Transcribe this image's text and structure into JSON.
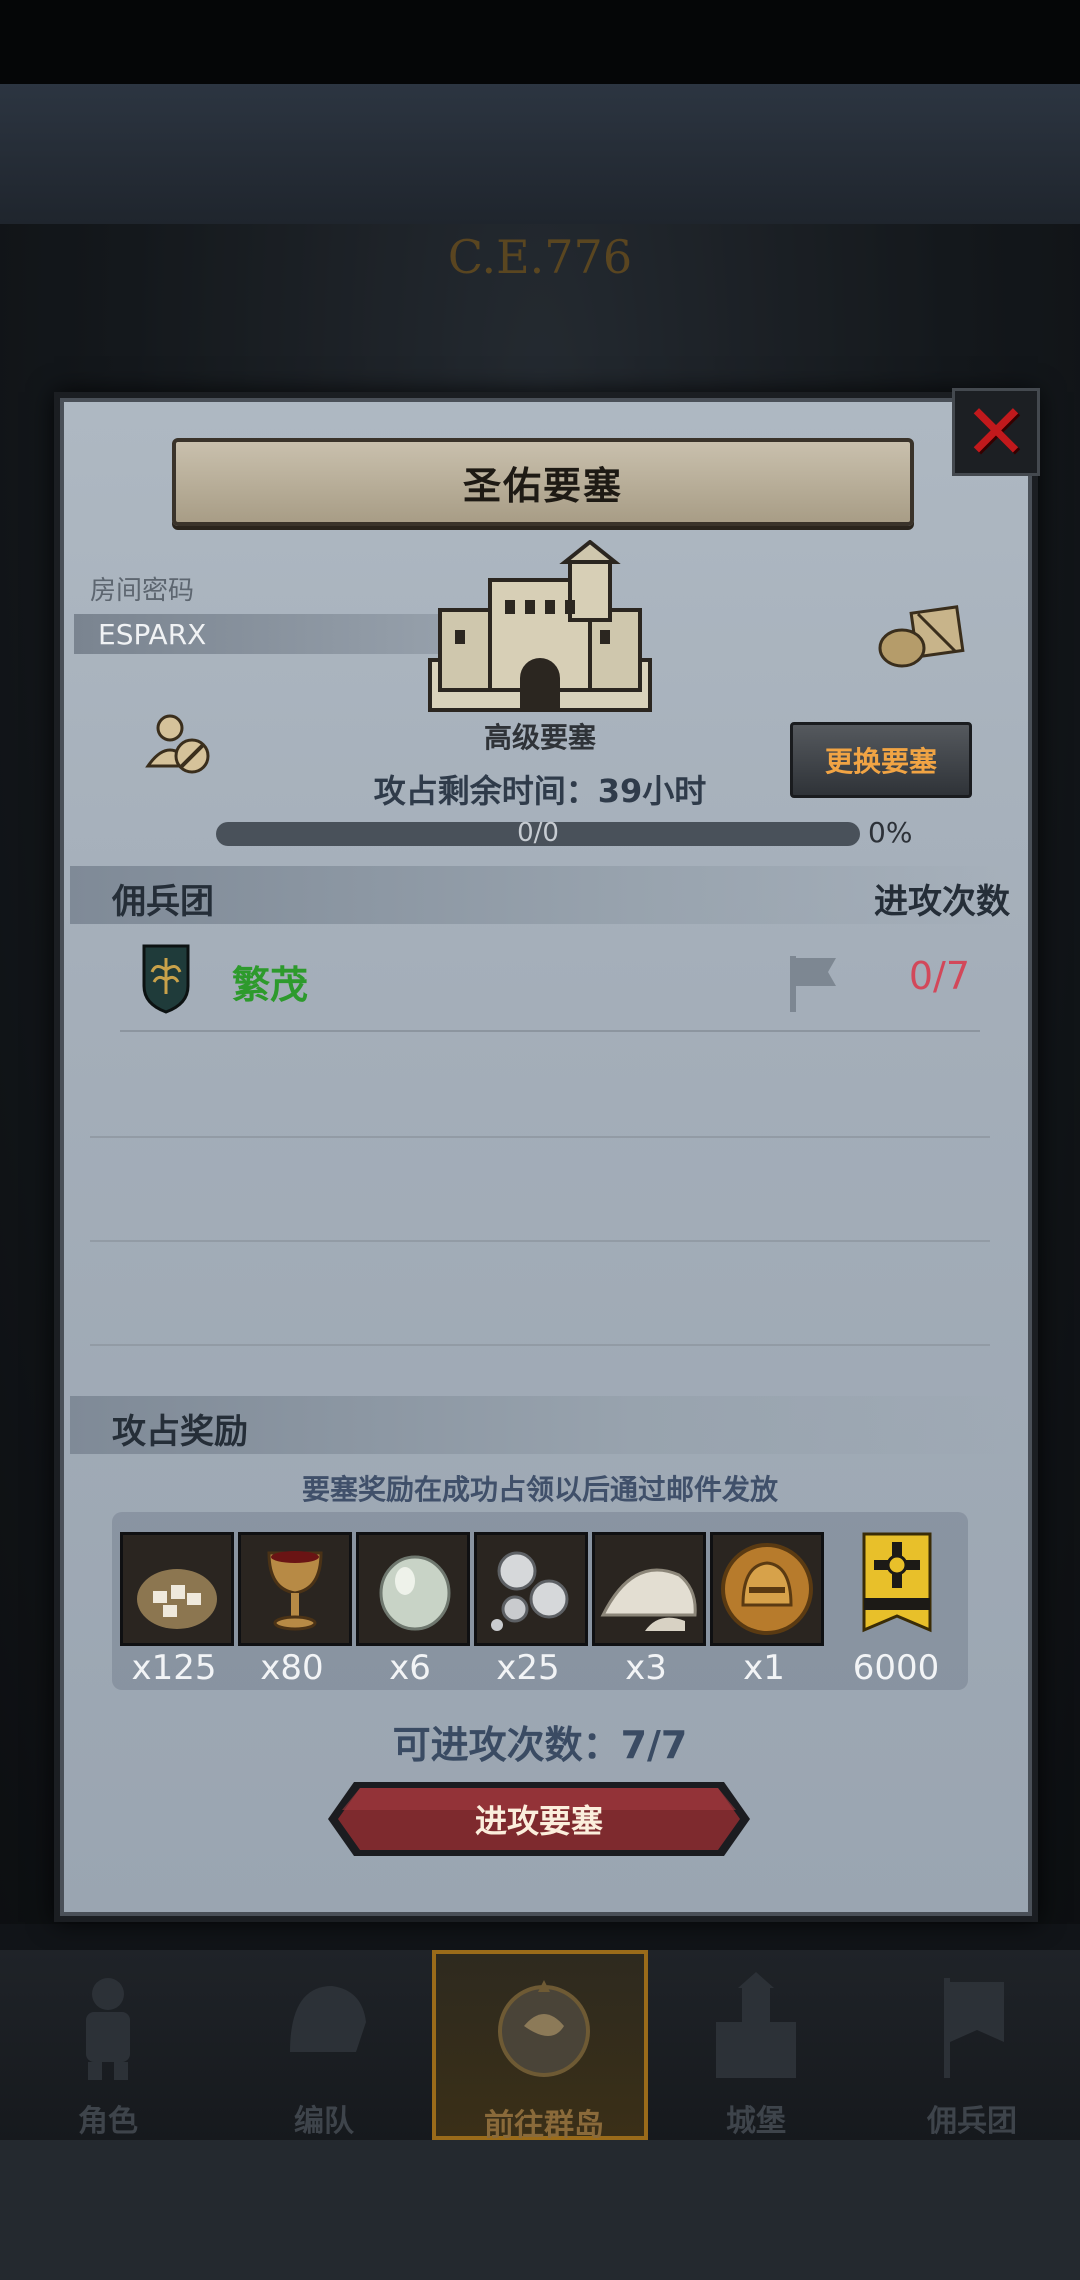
{
  "background": {
    "era": "C.E.776"
  },
  "dialog": {
    "title": "圣佑要塞",
    "room_password_label": "房间密码",
    "room_password": "ESPARX",
    "fortress_type": "高级要塞",
    "change_button": "更换要塞",
    "time_left": "攻占剩余时间：39小时",
    "progress": {
      "text": "0/0",
      "percent_label": "0%",
      "fraction": 0
    },
    "guild_section": {
      "left_label": "佣兵团",
      "right_label": "进攻次数"
    },
    "guilds": [
      {
        "name": "繁茂",
        "attacks": "0/7"
      }
    ],
    "reward_section": {
      "label": "攻占奖励",
      "note": "要塞奖励在成功占领以后通过邮件发放"
    },
    "rewards": [
      {
        "icon": "ore-sack-icon",
        "qty": "x125"
      },
      {
        "icon": "goblet-icon",
        "qty": "x80"
      },
      {
        "icon": "gem-stone-icon",
        "qty": "x6"
      },
      {
        "icon": "silver-pearls-icon",
        "qty": "x25"
      },
      {
        "icon": "powder-pile-icon",
        "qty": "x3"
      },
      {
        "icon": "helmet-medal-icon",
        "qty": "x1"
      },
      {
        "icon": "honor-badge-icon",
        "qty": "6000"
      }
    ],
    "attempts": "可进攻次数：7/7",
    "attack_button": "进攻要塞"
  },
  "nav": {
    "items": [
      {
        "label": "角色",
        "icon": "knight-icon"
      },
      {
        "label": "编队",
        "icon": "helmet-icon"
      },
      {
        "label": "前往群岛",
        "icon": "compass-icon",
        "active": true
      },
      {
        "label": "城堡",
        "icon": "castle-icon"
      },
      {
        "label": "佣兵团",
        "icon": "banner-icon"
      }
    ]
  },
  "colors": {
    "guild_green": "#2d9a2c",
    "attack_red": "#d2485a",
    "change_orange": "#f1a444",
    "close_red": "#c1191c"
  }
}
